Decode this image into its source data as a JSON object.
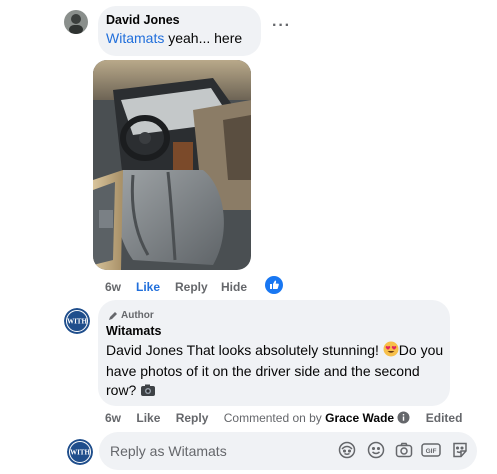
{
  "comment": {
    "author": "David Jones",
    "mention": "Witamats",
    "text": " yeah... here",
    "more_label": "···",
    "time": "6w",
    "like_label": "Like",
    "reply_label": "Reply",
    "hide_label": "Hide",
    "liked": true
  },
  "reply": {
    "badge": "Author",
    "author": "Witamats",
    "text_1": "David Jones That looks absolutely stunning! ",
    "text_2": "Do you have photos of it on the driver side and the second row? ",
    "time": "6w",
    "like_label": "Like",
    "reply_label": "Reply",
    "commented_on_prefix": "Commented on by",
    "commented_on_name": "Grace Wade",
    "edited_label": "Edited"
  },
  "composer": {
    "placeholder": "Reply as Witamats",
    "icons": [
      "avatar-sticker-icon",
      "emoji-icon",
      "camera-icon",
      "gif-icon",
      "sticker-icon"
    ]
  },
  "colors": {
    "accent": "#216fdb",
    "bubble": "#f0f2f5",
    "muted": "#65676b"
  }
}
